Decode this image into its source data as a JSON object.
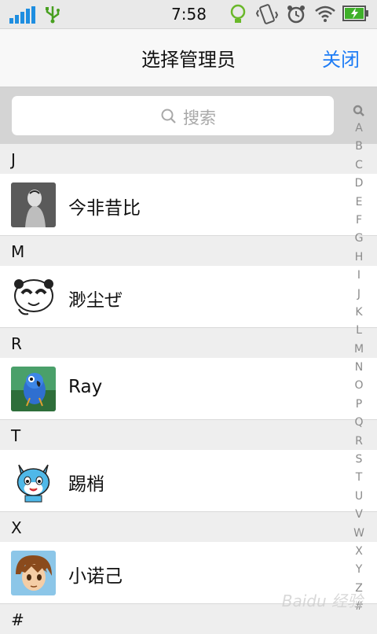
{
  "status_bar": {
    "time": "7:58",
    "icons": [
      "signal-icon",
      "usb-icon",
      "bulb-icon",
      "vibrate-icon",
      "alarm-icon",
      "wifi-icon",
      "battery-charging-icon"
    ]
  },
  "nav": {
    "title": "选择管理员",
    "close_label": "关闭"
  },
  "search": {
    "placeholder": "搜索"
  },
  "sections": [
    {
      "letter": "J",
      "contacts": [
        {
          "name": "今非昔比",
          "avatar": "dark-figure-avatar"
        }
      ]
    },
    {
      "letter": "M",
      "contacts": [
        {
          "name": "渺尘ぜ",
          "avatar": "panda-sketch-avatar"
        }
      ]
    },
    {
      "letter": "R",
      "contacts": [
        {
          "name": "Ray",
          "avatar": "blue-parrot-avatar"
        }
      ]
    },
    {
      "letter": "T",
      "contacts": [
        {
          "name": "踢梢",
          "avatar": "blue-cat-avatar"
        }
      ]
    },
    {
      "letter": "X",
      "contacts": [
        {
          "name": "小诺己",
          "avatar": "anime-boy-avatar"
        }
      ]
    },
    {
      "letter": "#",
      "contacts": []
    }
  ],
  "index_bar": {
    "letters": [
      "A",
      "B",
      "C",
      "D",
      "E",
      "F",
      "G",
      "H",
      "I",
      "J",
      "K",
      "L",
      "M",
      "N",
      "O",
      "P",
      "Q",
      "R",
      "S",
      "T",
      "U",
      "V",
      "W",
      "X",
      "Y",
      "Z",
      "#"
    ]
  },
  "watermark": "Baidu 经验"
}
